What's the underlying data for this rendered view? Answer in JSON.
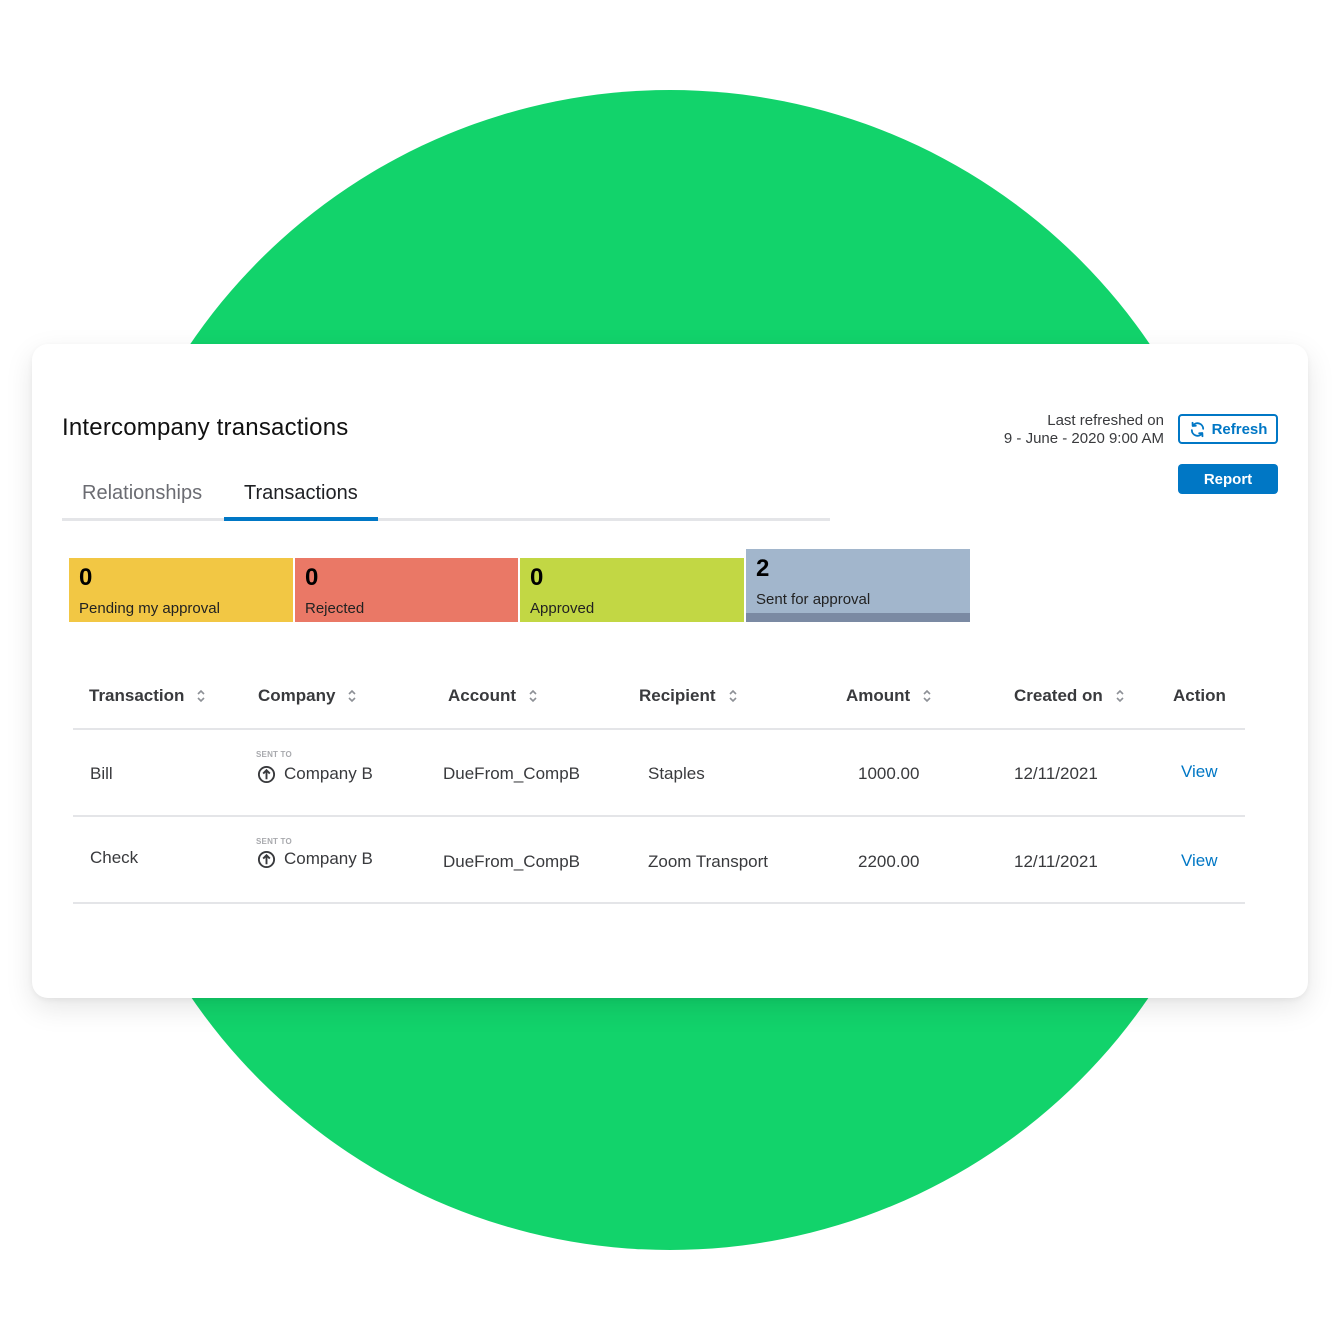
{
  "page": {
    "title": "Intercompany transactions",
    "tabs": [
      {
        "label": "Relationships",
        "active": false
      },
      {
        "label": "Transactions",
        "active": true
      }
    ],
    "last_refreshed_label": "Last refreshed on",
    "last_refreshed_value": "9 - June - 2020 9:00 AM",
    "refresh_button": "Refresh",
    "report_button": "Report"
  },
  "colors": {
    "accent": "#0077c5",
    "background_circle": "#12d36b",
    "pending": "#f2c744",
    "rejected": "#ea7866",
    "approved": "#c2d744",
    "sent": "#a2b6cc"
  },
  "stats": [
    {
      "count": "0",
      "label": "Pending my approval"
    },
    {
      "count": "0",
      "label": "Rejected"
    },
    {
      "count": "0",
      "label": "Approved"
    },
    {
      "count": "2",
      "label": "Sent for approval"
    }
  ],
  "table": {
    "columns": [
      "Transaction",
      "Company",
      "Account",
      "Recipient",
      "Amount",
      "Created on",
      "Action"
    ],
    "rows": [
      {
        "transaction": "Bill",
        "company_caption": "SENT TO",
        "company": "Company B",
        "account": "DueFrom_CompB",
        "recipient": "Staples",
        "amount": "1000.00",
        "created_on": "12/11/2021",
        "action": "View"
      },
      {
        "transaction": "Check",
        "company_caption": "SENT TO",
        "company": "Company B",
        "account": "DueFrom_CompB",
        "recipient": "Zoom Transport",
        "amount": "2200.00",
        "created_on": "12/11/2021",
        "action": "View"
      }
    ]
  }
}
